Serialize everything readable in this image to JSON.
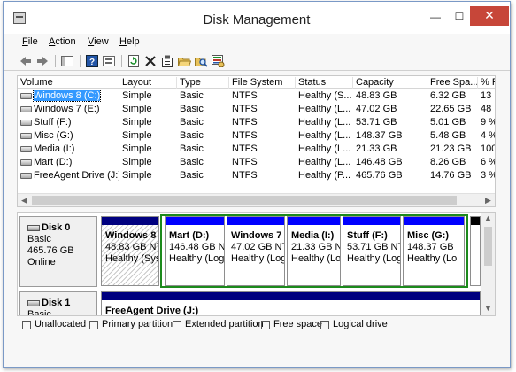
{
  "window": {
    "title": "Disk Management",
    "minimize_glyph": "—",
    "maximize_glyph": "☐",
    "close_glyph": "✕"
  },
  "menu": [
    {
      "label": "File",
      "underline": "F",
      "rest": "ile"
    },
    {
      "label": "Action",
      "underline": "A",
      "rest": "ction"
    },
    {
      "label": "View",
      "underline": "V",
      "rest": "iew"
    },
    {
      "label": "Help",
      "underline": "H",
      "rest": "elp"
    }
  ],
  "toolbar_icons": [
    "back-arrow-icon",
    "forward-arrow-icon",
    "console-tree-icon",
    "help-icon",
    "properties-list-icon",
    "refresh-icon",
    "delete-icon",
    "properties-icon",
    "open-folder-icon",
    "explore-icon",
    "disk-settings-icon"
  ],
  "volume_table": {
    "columns": [
      "Volume",
      "Layout",
      "Type",
      "File System",
      "Status",
      "Capacity",
      "Free Spa...",
      "% F"
    ],
    "rows": [
      [
        "Windows 8 (C:)",
        "Simple",
        "Basic",
        "NTFS",
        "Healthy (S...",
        "48.83 GB",
        "6.32 GB",
        "13"
      ],
      [
        "Windows 7 (E:)",
        "Simple",
        "Basic",
        "NTFS",
        "Healthy (L...",
        "47.02 GB",
        "22.65 GB",
        "48"
      ],
      [
        "Stuff (F:)",
        "Simple",
        "Basic",
        "NTFS",
        "Healthy (L...",
        "53.71 GB",
        "5.01 GB",
        "9 %"
      ],
      [
        "Misc (G:)",
        "Simple",
        "Basic",
        "NTFS",
        "Healthy (L...",
        "148.37 GB",
        "5.48 GB",
        "4 %"
      ],
      [
        "Media (I:)",
        "Simple",
        "Basic",
        "NTFS",
        "Healthy (L...",
        "21.33 GB",
        "21.23 GB",
        "100"
      ],
      [
        "Mart (D:)",
        "Simple",
        "Basic",
        "NTFS",
        "Healthy (L...",
        "146.48 GB",
        "8.26 GB",
        "6 %"
      ],
      [
        "FreeAgent Drive (J:)",
        "Simple",
        "Basic",
        "NTFS",
        "Healthy (P...",
        "465.76 GB",
        "14.76 GB",
        "3 %"
      ]
    ],
    "selected_row": 0
  },
  "disks": [
    {
      "name": "Disk 0",
      "type": "Basic",
      "size": "465.76 GB",
      "state": "Online",
      "partitions": [
        {
          "name": "Windows 8",
          "size": "48.83 GB NT",
          "status": "Healthy (Sys",
          "kind": "primary",
          "selected": true
        },
        {
          "name": "Mart  (D:)",
          "size": "146.48 GB NT",
          "status": "Healthy (Log",
          "kind": "logical"
        },
        {
          "name": "Windows 7",
          "size": "47.02 GB NT",
          "status": "Healthy (Log",
          "kind": "logical"
        },
        {
          "name": "Media  (I:)",
          "size": "21.33 GB NT",
          "status": "Healthy (Lo",
          "kind": "logical"
        },
        {
          "name": "Stuff  (F:)",
          "size": "53.71 GB NT",
          "status": "Healthy (Log",
          "kind": "logical"
        },
        {
          "name": "Misc  (G:)",
          "size": "148.37 GB",
          "status": "Healthy (Lo",
          "kind": "logical"
        }
      ]
    },
    {
      "name": "Disk 1",
      "type": "Basic",
      "partitions": [
        {
          "name": "FreeAgent Drive  (J:)",
          "kind": "primary"
        }
      ]
    }
  ],
  "legend": [
    {
      "label": "Unallocated",
      "color": "#000000"
    },
    {
      "label": "Primary partition",
      "color": "#00007f"
    },
    {
      "label": "Extended partition",
      "color": "#1c8a1c"
    },
    {
      "label": "Free space",
      "color": "#33cc33"
    },
    {
      "label": "Logical drive",
      "color": "#0000ff"
    }
  ],
  "scroll_glyphs": {
    "left": "◀",
    "right": "▶",
    "up": "▲",
    "down": "▼"
  }
}
